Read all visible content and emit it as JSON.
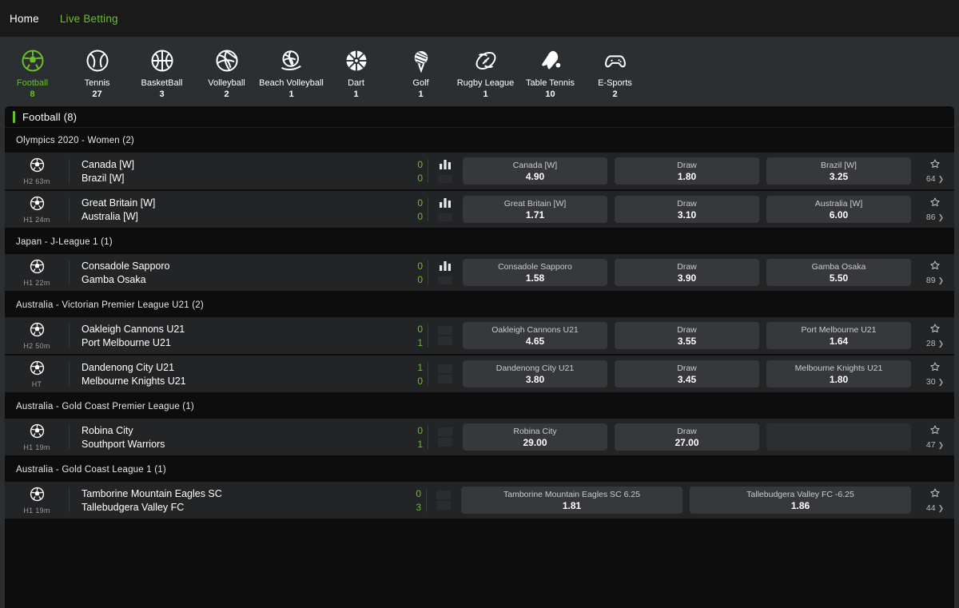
{
  "topnav": {
    "items": [
      {
        "label": "Home",
        "accent": false
      },
      {
        "label": "Live Betting",
        "accent": true
      }
    ]
  },
  "sports": [
    {
      "name": "Football",
      "count": "8",
      "icon": "football-icon",
      "active": true
    },
    {
      "name": "Tennis",
      "count": "27",
      "icon": "tennis-ball-icon",
      "active": false
    },
    {
      "name": "BasketBall",
      "count": "3",
      "icon": "basketball-icon",
      "active": false
    },
    {
      "name": "Volleyball",
      "count": "2",
      "icon": "volleyball-icon",
      "active": false
    },
    {
      "name": "Beach Volleyball",
      "count": "1",
      "icon": "beach-volleyball-icon",
      "active": false
    },
    {
      "name": "Dart",
      "count": "1",
      "icon": "dartboard-icon",
      "active": false
    },
    {
      "name": "Golf",
      "count": "1",
      "icon": "golf-ball-tee-icon",
      "active": false
    },
    {
      "name": "Rugby League",
      "count": "1",
      "icon": "rugby-ball-icon",
      "active": false
    },
    {
      "name": "Table Tennis",
      "count": "10",
      "icon": "table-tennis-icon",
      "active": false
    },
    {
      "name": "E-Sports",
      "count": "2",
      "icon": "gamepad-icon",
      "active": false
    }
  ],
  "section": {
    "title": "Football  (8)",
    "accent_color": "#6abf2a"
  },
  "leagues": [
    {
      "title": "Olympics 2020 - Women (2)",
      "matches": [
        {
          "period": "H2",
          "clock": "63m",
          "home": "Canada [W]",
          "away": "Brazil [W]",
          "home_score": "0",
          "away_score": "0",
          "stat": "chart",
          "odds": [
            {
              "label": "Canada [W]",
              "value": "4.90"
            },
            {
              "label": "Draw",
              "value": "1.80"
            },
            {
              "label": "Brazil [W]",
              "value": "3.25"
            }
          ],
          "more_count": "64"
        },
        {
          "period": "H1",
          "clock": "24m",
          "home": "Great Britain [W]",
          "away": "Australia [W]",
          "home_score": "0",
          "away_score": "0",
          "stat": "chart",
          "odds": [
            {
              "label": "Great Britain [W]",
              "value": "1.71"
            },
            {
              "label": "Draw",
              "value": "3.10"
            },
            {
              "label": "Australia [W]",
              "value": "6.00"
            }
          ],
          "more_count": "86"
        }
      ]
    },
    {
      "title": "Japan - J-League 1  (1)",
      "matches": [
        {
          "period": "H1",
          "clock": "22m",
          "home": "Consadole Sapporo",
          "away": "Gamba Osaka",
          "home_score": "0",
          "away_score": "0",
          "stat": "chart",
          "odds": [
            {
              "label": "Consadole Sapporo",
              "value": "1.58"
            },
            {
              "label": "Draw",
              "value": "3.90"
            },
            {
              "label": "Gamba Osaka",
              "value": "5.50"
            }
          ],
          "more_count": "89"
        }
      ]
    },
    {
      "title": "Australia - Victorian Premier League U21 (2)",
      "matches": [
        {
          "period": "H2",
          "clock": "50m",
          "home": "Oakleigh Cannons U21",
          "away": "Port Melbourne U21",
          "home_score": "0",
          "away_score": "1",
          "stat": "placeholder",
          "odds": [
            {
              "label": "Oakleigh Cannons U21",
              "value": "4.65"
            },
            {
              "label": "Draw",
              "value": "3.55"
            },
            {
              "label": "Port Melbourne U21",
              "value": "1.64"
            }
          ],
          "more_count": "28"
        },
        {
          "period": "HT",
          "clock": "",
          "home": "Dandenong City U21",
          "away": "Melbourne Knights U21",
          "home_score": "1",
          "away_score": "0",
          "stat": "placeholder",
          "odds": [
            {
              "label": "Dandenong City U21",
              "value": "3.80"
            },
            {
              "label": "Draw",
              "value": "3.45"
            },
            {
              "label": "Melbourne Knights U21",
              "value": "1.80"
            }
          ],
          "more_count": "30"
        }
      ]
    },
    {
      "title": "Australia - Gold Coast Premier League (1)",
      "matches": [
        {
          "period": "H1",
          "clock": "19m",
          "home": "Robina City",
          "away": "Southport Warriors",
          "home_score": "0",
          "away_score": "1",
          "stat": "placeholder",
          "odds": [
            {
              "label": "Robina City",
              "value": "29.00"
            },
            {
              "label": "Draw",
              "value": "27.00"
            },
            {
              "label": "",
              "value": ""
            }
          ],
          "more_count": "47"
        }
      ]
    },
    {
      "title": "Australia - Gold Coast League 1 (1)",
      "matches": [
        {
          "period": "H1",
          "clock": "19m",
          "home": "Tamborine Mountain Eagles SC",
          "away": "Tallebudgera Valley FC",
          "home_score": "0",
          "away_score": "3",
          "stat": "placeholder",
          "layout": "handicap",
          "odds": [
            {
              "label": "Tamborine Mountain Eagles SC  6.25",
              "value": "1.81"
            },
            {
              "label": "Tallebudgera Valley FC  -6.25",
              "value": "1.86"
            }
          ],
          "more_count": "44"
        }
      ]
    }
  ]
}
